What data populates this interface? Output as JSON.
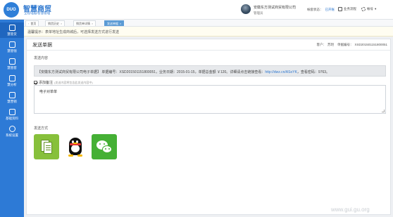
{
  "header": {
    "logo_mark": "DUO",
    "app_title": "智慧商贸",
    "app_subtitle": "全程电脑/智慧管理",
    "company": "安徽东方测试商贸有限公司",
    "role": "管理员",
    "status_label": "帐套状态：",
    "status_value": "已开账",
    "process_label": "业务流程",
    "settings_label": "帐号"
  },
  "sidebar": {
    "items": [
      {
        "label": "慧管货",
        "icon": "package-icon"
      },
      {
        "label": "慧管钱",
        "icon": "wallet-icon"
      },
      {
        "label": "慧管客",
        "icon": "users-icon"
      },
      {
        "label": "慧分析",
        "icon": "chart-icon"
      },
      {
        "label": "慧营销",
        "icon": "tag-icon"
      },
      {
        "label": "基础资料",
        "icon": "book-icon"
      },
      {
        "label": "系统设置",
        "icon": "gear-icon"
      }
    ]
  },
  "tabs": [
    {
      "label": "首页"
    },
    {
      "label": "销货历史"
    },
    {
      "label": "销货单详情"
    },
    {
      "label": "发送单据"
    }
  ],
  "tips": "温馨提示：表单地址生成商城后，可选择发送方式进行发送",
  "panel": {
    "title": "发送单据",
    "customer_label": "客户：",
    "customer_value": "苏玥",
    "doc_label": "单据编号：",
    "doc_value": "XSD201501151800051"
  },
  "content": {
    "label": "发送内容",
    "text_prefix": "【安徽东方测试商贸有限公司电子单据】  单据编号：XSD201501151800051，业务日期：2015-01-15，单据总金额 ￥120。详细请点击链接查看：",
    "link": "http://dwz.cn/ASoYK",
    "text_suffix": "，查看密码：9763。"
  },
  "remark": {
    "label": "添加备注",
    "hint": "(发送内容将包含此发送内容中)",
    "value": "电子对单单"
  },
  "send": {
    "label": "发送方式",
    "methods": [
      {
        "name": "file",
        "icon": "file-copy-icon"
      },
      {
        "name": "qq",
        "icon": "qq-icon"
      },
      {
        "name": "wechat",
        "icon": "wechat-icon"
      }
    ]
  },
  "watermark": "www.gui.gu.org"
}
